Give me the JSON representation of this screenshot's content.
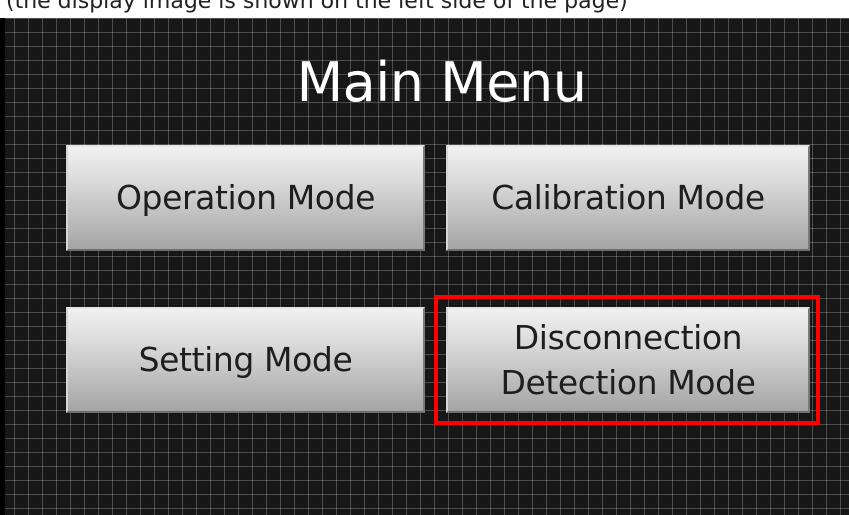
{
  "caption": {
    "text": "(the display image is shown on the left side of the page)"
  },
  "screen": {
    "title": "Main Menu",
    "buttons": {
      "operation": "Operation Mode",
      "calibration": "Calibration Mode",
      "setting": "Setting Mode",
      "disconnection": "Disconnection Detection Mode"
    },
    "highlighted_button": "disconnection",
    "highlight_color": "#ff0000"
  }
}
